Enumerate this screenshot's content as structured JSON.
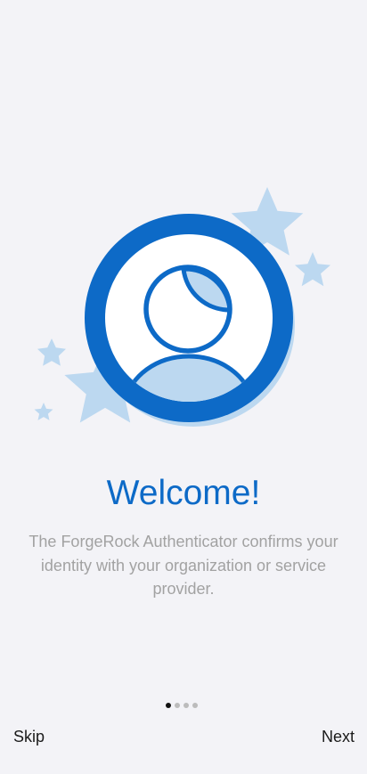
{
  "onboarding": {
    "title": "Welcome!",
    "description": "The ForgeRock Authenticator confirms your identity with your organization or service provider.",
    "pager": {
      "total_pages": 4,
      "current_page": 1
    },
    "skip_label": "Skip",
    "next_label": "Next"
  },
  "colors": {
    "background": "#f3f3f7",
    "accent_blue": "#0d6ac7",
    "light_blue": "#bcd8f0",
    "text_gray": "#a2a2a2"
  }
}
